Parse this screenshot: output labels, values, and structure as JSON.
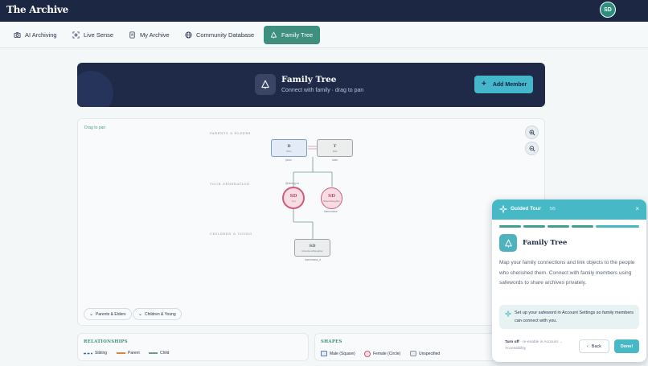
{
  "app": {
    "brand": "The Archive",
    "user_initials": "SD"
  },
  "nav": {
    "items": [
      {
        "label": "AI Archiving",
        "icon": "camera-icon",
        "active": false
      },
      {
        "label": "Live Sense",
        "icon": "scan-icon",
        "active": false
      },
      {
        "label": "My Archive",
        "icon": "book-icon",
        "active": false
      },
      {
        "label": "Community Database",
        "icon": "globe-icon",
        "active": false
      },
      {
        "label": "Family Tree",
        "icon": "tree-icon",
        "active": true
      }
    ]
  },
  "hero": {
    "title": "Family Tree",
    "subtitle": "Connect with family · drag to pan",
    "add_label": "Add Member"
  },
  "canvas": {
    "drag_hint": "Drag to pan",
    "generations": [
      "PARENTS & ELDERS",
      "YOUR GENERATION",
      "CHILDREN & YOUNG"
    ],
    "nodes": {
      "parent1": {
        "initial": "B",
        "role": "Mom",
        "caption": "pious"
      },
      "parent2": {
        "initial": "T",
        "role": "Dad",
        "caption": "dude"
      },
      "self": {
        "initial": "SD",
        "role": "You",
        "caption": "@vindog.sa"
      },
      "sibling": {
        "initial": "SD",
        "role": "Sister/Daughter",
        "caption": "dummmsss"
      },
      "child": {
        "initial": "SD",
        "role": "Grandson/Daughter",
        "caption": "dummmsss_d"
      }
    },
    "filters": {
      "parents": "Parents & Elders",
      "children": "Children & Young"
    }
  },
  "legend": {
    "relationships": {
      "title": "RELATIONSHIPS",
      "items": [
        {
          "label": "Sibling",
          "color": "#2f6f8f",
          "dashed": true
        },
        {
          "label": "Parent",
          "color": "#e0823a",
          "dashed": false
        },
        {
          "label": "Child",
          "color": "#6b9a86",
          "dashed": false
        }
      ]
    },
    "shapes": {
      "title": "SHAPES",
      "items": [
        {
          "label": "Male (Square)"
        },
        {
          "label": "Female (Circle)"
        },
        {
          "label": "Unspecified"
        }
      ]
    }
  },
  "tour": {
    "title": "Guided Tour",
    "step": "5/5",
    "progress_segments": 6,
    "progress_completed": 6,
    "heading": "Family Tree",
    "body": "Map your family connections and link objects to the people who cherished them. Connect with family members using safewords to share archives privately.",
    "tip": "Set up your safeword in Account Settings so family members can connect with you.",
    "turn_off": "Turn off",
    "turn_off_hint": "· re-enable in Account → Accessibility",
    "back_label": "Back",
    "done_label": "Done!"
  },
  "colors": {
    "navy": "#1c2744",
    "accent_green": "#3f8f7f",
    "accent_teal": "#46b8c6",
    "female": "#cf5a7a",
    "male_border": "#7a9cc8"
  }
}
